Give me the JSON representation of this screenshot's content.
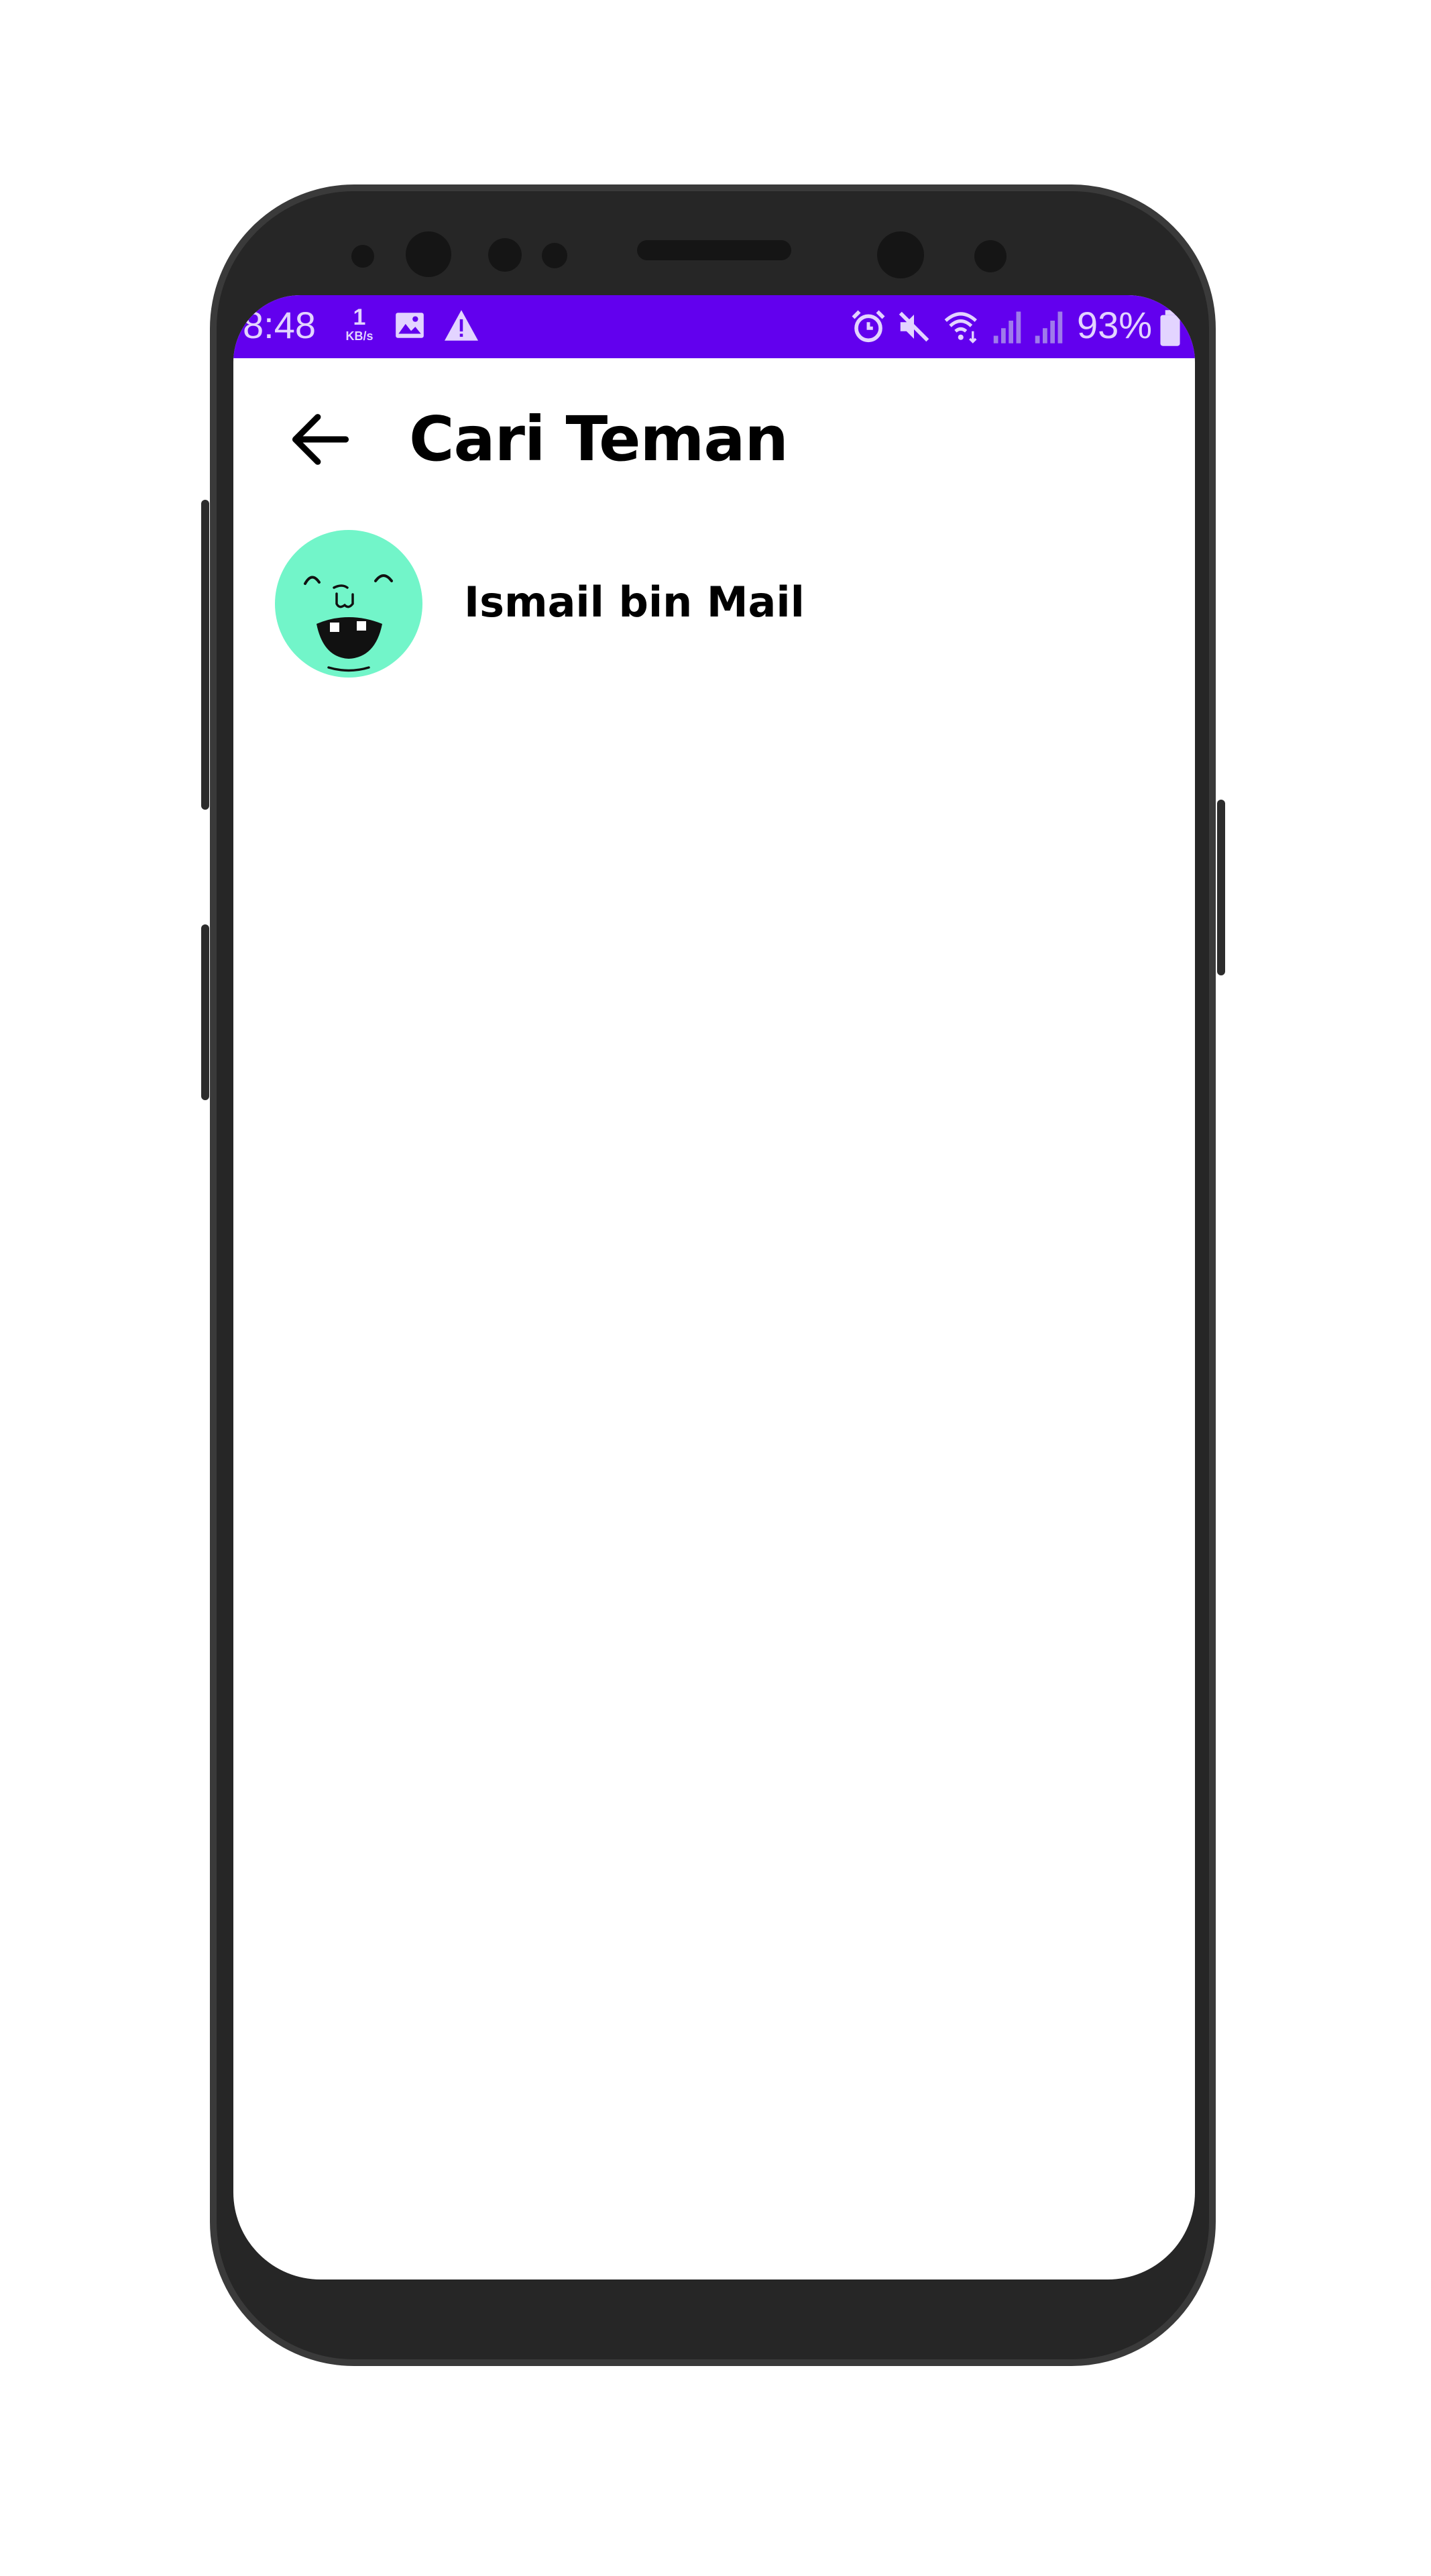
{
  "status_bar": {
    "time": "8:48",
    "net_speed_value": "1",
    "net_speed_unit": "KB/s",
    "battery_percent": "93%",
    "background": "#6200ee",
    "icons_left": [
      "gallery-icon",
      "warning-icon"
    ],
    "icons_right": [
      "alarm-icon",
      "mute-icon",
      "wifi-icon",
      "signal-icon",
      "signal-icon",
      "battery-icon"
    ]
  },
  "app_bar": {
    "back_icon": "arrow-left-icon",
    "title": "Cari Teman"
  },
  "friends": [
    {
      "name": "Ismail bin Mail",
      "avatar_color": "#72f5c9",
      "avatar_icon": "laughing-face-avatar"
    }
  ]
}
